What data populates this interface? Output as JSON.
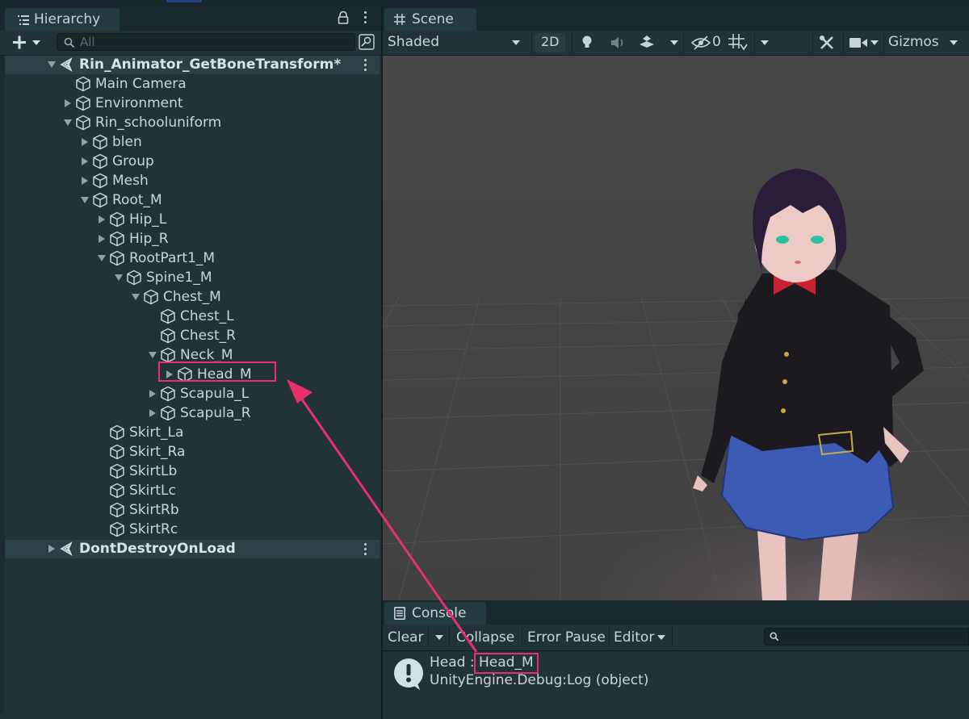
{
  "hierarchy": {
    "tab_title": "Hierarchy",
    "search_placeholder": "All",
    "rows": [
      {
        "label": "Rin_Animator_GetBoneTransform*",
        "kind": "scene",
        "expanded": true
      },
      {
        "label": "Main Camera",
        "kind": "object",
        "expanded": null
      },
      {
        "label": "Environment",
        "kind": "object",
        "expanded": false
      },
      {
        "label": "Rin_schooluniform",
        "kind": "object",
        "expanded": true
      },
      {
        "label": "blen",
        "kind": "object",
        "expanded": false
      },
      {
        "label": "Group",
        "kind": "object",
        "expanded": false
      },
      {
        "label": "Mesh",
        "kind": "object",
        "expanded": false
      },
      {
        "label": "Root_M",
        "kind": "object",
        "expanded": true
      },
      {
        "label": "Hip_L",
        "kind": "object",
        "expanded": false
      },
      {
        "label": "Hip_R",
        "kind": "object",
        "expanded": false
      },
      {
        "label": "RootPart1_M",
        "kind": "object",
        "expanded": true
      },
      {
        "label": "Spine1_M",
        "kind": "object",
        "expanded": true
      },
      {
        "label": "Chest_M",
        "kind": "object",
        "expanded": true
      },
      {
        "label": "Chest_L",
        "kind": "object",
        "expanded": null
      },
      {
        "label": "Chest_R",
        "kind": "object",
        "expanded": null
      },
      {
        "label": "Neck_M",
        "kind": "object",
        "expanded": true
      },
      {
        "label": "Head_M",
        "kind": "object",
        "expanded": false,
        "highlighted": true
      },
      {
        "label": "Scapula_L",
        "kind": "object",
        "expanded": false
      },
      {
        "label": "Scapula_R",
        "kind": "object",
        "expanded": false
      },
      {
        "label": "Skirt_La",
        "kind": "object",
        "expanded": null
      },
      {
        "label": "Skirt_Ra",
        "kind": "object",
        "expanded": null
      },
      {
        "label": "SkirtLb",
        "kind": "object",
        "expanded": null
      },
      {
        "label": "SkirtLc",
        "kind": "object",
        "expanded": null
      },
      {
        "label": "SkirtRb",
        "kind": "object",
        "expanded": null
      },
      {
        "label": "SkirtRc",
        "kind": "object",
        "expanded": null
      },
      {
        "label": "DontDestroyOnLoad",
        "kind": "scene",
        "expanded": false
      }
    ]
  },
  "scene": {
    "tab_title": "Scene",
    "draw_mode": "Shaded",
    "mode_2d": "2D",
    "hidden_count": "0",
    "gizmos": "Gizmos"
  },
  "console": {
    "tab_title": "Console",
    "clear": "Clear",
    "collapse": "Collapse",
    "error_pause": "Error Pause",
    "editor": "Editor",
    "log_prefix": "Head : ",
    "log_value": "Head_M",
    "log_trace": "UnityEngine.Debug:Log (object)"
  },
  "colors": {
    "accent_highlight": "#e8306c",
    "panel_bg": "#223338",
    "tab_bg": "#1a292d",
    "viewport_bg": "#454545"
  }
}
